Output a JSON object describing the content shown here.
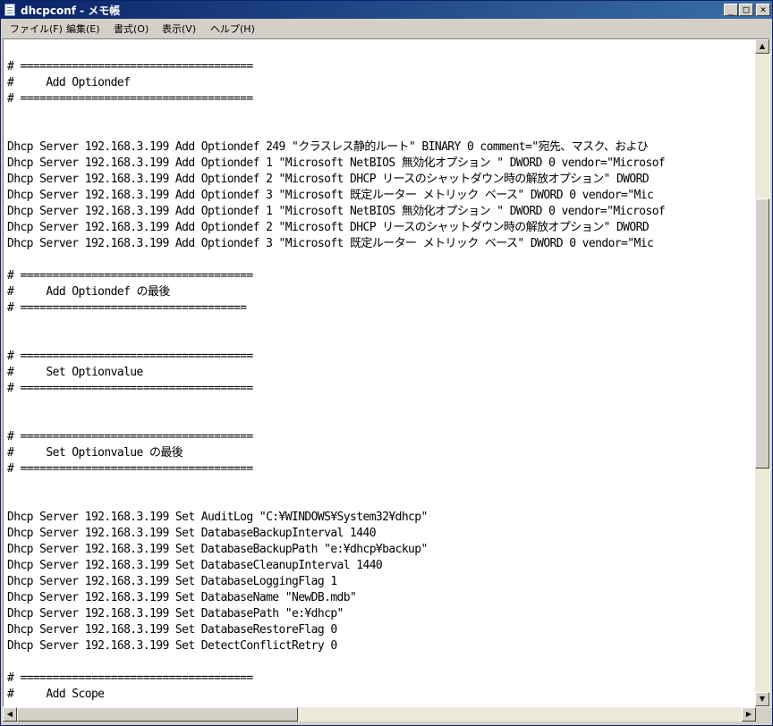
{
  "window": {
    "title": "dhcpconf - メモ帳",
    "minimize_glyph": "_",
    "maximize_glyph": "□",
    "close_glyph": "×"
  },
  "menu": {
    "items": [
      {
        "label": "ファイル(F)"
      },
      {
        "label": "編集(E)"
      },
      {
        "label": "書式(O)"
      },
      {
        "label": "表示(V)"
      },
      {
        "label": "ヘルプ(H)"
      }
    ]
  },
  "editor": {
    "lines": [
      "# ====================================",
      "#     Add Optiondef",
      "# ====================================",
      "",
      "",
      "Dhcp Server 192.168.3.199 Add Optiondef 249 \"クラスレス静的ルート\" BINARY 0 comment=\"宛先、マスク、およひ",
      "Dhcp Server 192.168.3.199 Add Optiondef 1 \"Microsoft NetBIOS 無効化オプション \" DWORD 0 vendor=\"Microsof",
      "Dhcp Server 192.168.3.199 Add Optiondef 2 \"Microsoft DHCP リースのシャットダウン時の解放オプション\" DWORD",
      "Dhcp Server 192.168.3.199 Add Optiondef 3 \"Microsoft 既定ルーター メトリック ベース\" DWORD 0 vendor=\"Mic",
      "Dhcp Server 192.168.3.199 Add Optiondef 1 \"Microsoft NetBIOS 無効化オプション \" DWORD 0 vendor=\"Microsof",
      "Dhcp Server 192.168.3.199 Add Optiondef 2 \"Microsoft DHCP リースのシャットダウン時の解放オプション\" DWORD",
      "Dhcp Server 192.168.3.199 Add Optiondef 3 \"Microsoft 既定ルーター メトリック ベース\" DWORD 0 vendor=\"Mic",
      "",
      "# ====================================",
      "#     Add Optiondef の最後",
      "# ===================================",
      "",
      "",
      "# ====================================",
      "#     Set Optionvalue",
      "# ====================================",
      "",
      "",
      "# ====================================",
      "#     Set Optionvalue の最後",
      "# ====================================",
      "",
      "",
      "Dhcp Server 192.168.3.199 Set AuditLog \"C:¥WINDOWS¥System32¥dhcp\"",
      "Dhcp Server 192.168.3.199 Set DatabaseBackupInterval 1440",
      "Dhcp Server 192.168.3.199 Set DatabaseBackupPath \"e:¥dhcp¥backup\"",
      "Dhcp Server 192.168.3.199 Set DatabaseCleanupInterval 1440",
      "Dhcp Server 192.168.3.199 Set DatabaseLoggingFlag 1",
      "Dhcp Server 192.168.3.199 Set DatabaseName \"NewDB.mdb\"",
      "Dhcp Server 192.168.3.199 Set DatabasePath \"e:¥dhcp\"",
      "Dhcp Server 192.168.3.199 Set DatabaseRestoreFlag 0",
      "Dhcp Server 192.168.3.199 Set DetectConflictRetry 0",
      "",
      "# ====================================",
      "#     Add Scope"
    ]
  },
  "scrollbars": {
    "up_glyph": "▲",
    "down_glyph": "▼",
    "left_glyph": "◀",
    "right_glyph": "▶"
  }
}
